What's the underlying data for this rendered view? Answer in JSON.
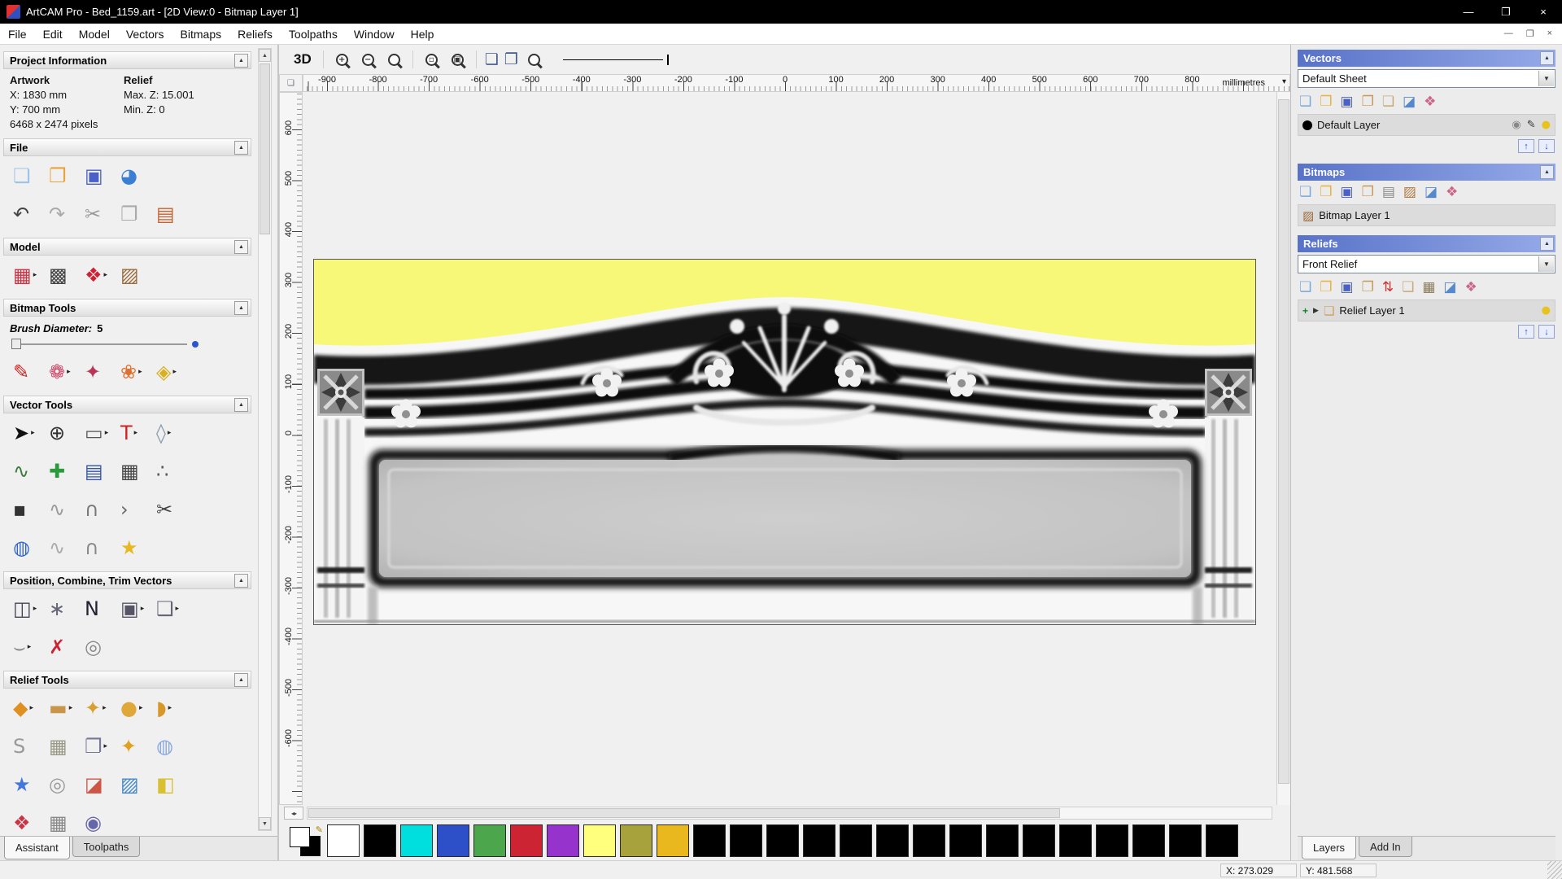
{
  "ui": {
    "collapse_glyph": "▲",
    "dropdown_glyph": "▼",
    "flyout_glyph": "▸",
    "updown": [
      "↑",
      "↓"
    ],
    "hsplit_glyph": "◂▸",
    "ruler_corner_glyph": "❏",
    "ruler_drop_glyph": "▾",
    "header_blue_from": "#5872c8",
    "header_blue_to": "#95aae8",
    "palette_edit_glyph": "✎"
  },
  "titlebar": {
    "title": "ArtCAM Pro - Bed_1159.art - [2D View:0 - Bitmap Layer 1]",
    "minimize": "—",
    "maximize": "❐",
    "close": "×"
  },
  "menubar": {
    "items": [
      "File",
      "Edit",
      "Model",
      "Vectors",
      "Bitmaps",
      "Reliefs",
      "Toolpaths",
      "Window",
      "Help"
    ],
    "mdi": [
      {
        "name": "mdi-minimize-button",
        "glyph": "—"
      },
      {
        "name": "mdi-restore-button",
        "glyph": "❐"
      },
      {
        "name": "mdi-close-button",
        "glyph": "×"
      }
    ]
  },
  "left_panel": {
    "project_info": {
      "title": "Project Information",
      "artwork_label": "Artwork",
      "relief_label": "Relief",
      "x_value": "X: 1830 mm",
      "max_z": "Max. Z: 15.001",
      "y_value": "Y: 700 mm",
      "min_z": "Min. Z: 0",
      "pixels": "6468 x 2474 pixels"
    },
    "file": {
      "title": "File",
      "row1": [
        {
          "name": "new-model-icon",
          "glyph": "❏",
          "color": "#9ec2e8"
        },
        {
          "name": "open-model-icon",
          "glyph": "❐",
          "color": "#e8a33d"
        },
        {
          "name": "save-model-icon",
          "glyph": "▣",
          "color": "#4a5fc8"
        },
        {
          "name": "model-transfer-icon",
          "glyph": "◕",
          "color": "#3a7fd4"
        }
      ],
      "row2": [
        {
          "name": "undo-icon",
          "glyph": "↶",
          "color": "#444444"
        },
        {
          "name": "redo-icon",
          "glyph": "↷",
          "color": "#aaaaaa"
        },
        {
          "name": "cut-icon",
          "glyph": "✂",
          "color": "#999999"
        },
        {
          "name": "copy-icon",
          "glyph": "❐",
          "color": "#aaaaaa"
        },
        {
          "name": "paste-icon",
          "glyph": "▤",
          "color": "#c86030"
        }
      ]
    },
    "model": {
      "title": "Model",
      "row1": [
        {
          "name": "set-model-size-icon",
          "glyph": "▦",
          "color": "#cc3344",
          "arrow": true
        },
        {
          "name": "model-notes-icon",
          "glyph": "▩",
          "color": "#444444"
        },
        {
          "name": "relief-sculpt-icon",
          "glyph": "❖",
          "color": "#cc2233",
          "arrow": true
        },
        {
          "name": "load-bitmap-icon",
          "glyph": "▨",
          "color": "#9a6a3a"
        }
      ]
    },
    "bitmap_tools": {
      "title": "Bitmap Tools",
      "brush_label": "Brush Diameter:",
      "brush_value": "5",
      "row1": [
        {
          "name": "paint-brush-icon",
          "glyph": "✎",
          "color": "#cc2222"
        },
        {
          "name": "paint-selective-icon",
          "glyph": "❁",
          "color": "#cc4466",
          "arrow": true
        },
        {
          "name": "colour-picker-icon",
          "glyph": "✦",
          "color": "#bb3355"
        },
        {
          "name": "colour-palette-icon",
          "glyph": "❀",
          "color": "#e07030",
          "arrow": true
        },
        {
          "name": "flood-fill-icon",
          "glyph": "◈",
          "color": "#d8b020",
          "arrow": true
        }
      ]
    },
    "vector_tools": {
      "title": "Vector Tools",
      "row1": [
        {
          "name": "select-vectors-icon",
          "glyph": "➤",
          "color": "#111111",
          "arrow": true
        },
        {
          "name": "transform-vectors-icon",
          "glyph": "⊕",
          "color": "#333333"
        },
        {
          "name": "create-rectangle-icon",
          "glyph": "▭",
          "color": "#555555",
          "arrow": true
        },
        {
          "name": "create-text-icon",
          "glyph": "T",
          "color": "#cc2222",
          "arrow": true
        },
        {
          "name": "measure-icon",
          "glyph": "◊",
          "color": "#8899aa",
          "arrow": true
        }
      ],
      "row2": [
        {
          "name": "create-polyline-icon",
          "glyph": "∿",
          "color": "#3a7a3a"
        },
        {
          "name": "snap-options-icon",
          "glyph": "✚",
          "color": "#2a9a3a"
        },
        {
          "name": "text-block-icon",
          "glyph": "▤",
          "color": "#3355aa"
        },
        {
          "name": "bitmap-to-vector-icon",
          "glyph": "▦",
          "color": "#444444"
        },
        {
          "name": "node-editing-icon",
          "glyph": "∴",
          "color": "#555555"
        }
      ],
      "row3": [
        {
          "name": "create-point-icon",
          "glyph": "▪",
          "color": "#333333"
        },
        {
          "name": "freehand-curve-icon",
          "glyph": "∿",
          "color": "#999999"
        },
        {
          "name": "create-arc-icon",
          "glyph": "∩",
          "color": "#777777"
        },
        {
          "name": "polyline-segment-icon",
          "glyph": "›",
          "color": "#666666"
        },
        {
          "name": "trim-vectors-icon",
          "glyph": "✂",
          "color": "#444444"
        }
      ],
      "row4": [
        {
          "name": "offset-vectors-icon",
          "glyph": "◍",
          "color": "#3366cc"
        },
        {
          "name": "fillet-icon",
          "glyph": "∿",
          "color": "#aaaaaa"
        },
        {
          "name": "join-vectors-icon",
          "glyph": "∩",
          "color": "#888888"
        },
        {
          "name": "vector-wizard-icon",
          "glyph": "★",
          "color": "#e8b820"
        }
      ]
    },
    "position_tools": {
      "title": "Position, Combine, Trim Vectors",
      "row1": [
        {
          "name": "align-vectors-icon",
          "glyph": "◫",
          "color": "#444455",
          "arrow": true
        },
        {
          "name": "array-copy-icon",
          "glyph": "∗",
          "color": "#666677"
        },
        {
          "name": "nesting-icon",
          "glyph": "N",
          "color": "#222233"
        },
        {
          "name": "group-vectors-icon",
          "glyph": "▣",
          "color": "#555566",
          "arrow": true
        },
        {
          "name": "weld-vectors-icon",
          "glyph": "❑",
          "color": "#666677",
          "arrow": true
        }
      ],
      "row2": [
        {
          "name": "slice-vectors-icon",
          "glyph": "⌣",
          "color": "#888888",
          "arrow": true
        },
        {
          "name": "vector-doctor-icon",
          "glyph": "✗",
          "color": "#cc2233"
        },
        {
          "name": "fit-spiral-icon",
          "glyph": "◎",
          "color": "#888888"
        }
      ]
    },
    "relief_tools": {
      "title": "Relief Tools",
      "row1": [
        {
          "name": "shape-editor-icon",
          "glyph": "◆",
          "color": "#e09020",
          "arrow": true
        },
        {
          "name": "smooth-relief-icon",
          "glyph": "▬",
          "color": "#c8954a",
          "arrow": true
        },
        {
          "name": "sculpting-icon",
          "glyph": "✦",
          "color": "#d8a030",
          "arrow": true
        },
        {
          "name": "add-subtract-relief-icon",
          "glyph": "●",
          "color": "#e0a838",
          "arrow": true
        },
        {
          "name": "relief-properties-icon",
          "glyph": "◗",
          "color": "#d89828",
          "arrow": true
        }
      ],
      "row2": [
        {
          "name": "smoothing-icon",
          "glyph": "S",
          "color": "#999999"
        },
        {
          "name": "texture-relief-icon",
          "glyph": "▦",
          "color": "#999988"
        },
        {
          "name": "relief-from-image-icon",
          "glyph": "❐",
          "color": "#777799",
          "arrow": true
        },
        {
          "name": "interactive-sculpt-icon",
          "glyph": "✦",
          "color": "#e0a020"
        },
        {
          "name": "dome-relief-icon",
          "glyph": "◍",
          "color": "#88a8e0"
        }
      ],
      "row3": [
        {
          "name": "star-wizard-icon",
          "glyph": "★",
          "color": "#4477dd"
        },
        {
          "name": "swirl-relief-icon",
          "glyph": "◎",
          "color": "#999999"
        },
        {
          "name": "angled-plane-icon",
          "glyph": "◪",
          "color": "#cc5544"
        },
        {
          "name": "weave-wizard-icon",
          "glyph": "▨",
          "color": "#4488cc"
        },
        {
          "name": "extrude-icon",
          "glyph": "◧",
          "color": "#d8c030"
        }
      ],
      "row4": [
        {
          "name": "two-rail-sweep-icon",
          "glyph": "❖",
          "color": "#cc3344"
        },
        {
          "name": "turn-model-icon",
          "glyph": "▦",
          "color": "#888888"
        },
        {
          "name": "isolate-relief-icon",
          "glyph": "◉",
          "color": "#6666aa"
        }
      ]
    },
    "tabs": [
      {
        "name": "tab-assistant",
        "label": "Assistant",
        "active": true
      },
      {
        "name": "tab-toolpaths",
        "label": "Toolpaths",
        "active": false
      }
    ]
  },
  "canvas": {
    "toolbar": {
      "view3d_label": "3D",
      "zoom_in_sym": "+",
      "zoom_out_sym": "−",
      "zoom_box_sym": "▫",
      "zoom_fit_sym": "▣",
      "page_sym": "❏",
      "objects_sym": "❐"
    },
    "ruler_h": [
      "-900",
      "-800",
      "-700",
      "-600",
      "-500",
      "-400",
      "-300",
      "-200",
      "-100",
      "0",
      "100",
      "200",
      "300",
      "400",
      "500",
      "600",
      "700",
      "800"
    ],
    "ruler_v": [
      "600",
      "500",
      "400",
      "300",
      "200",
      "100",
      "0",
      "-100",
      "-200",
      "-300",
      "-400",
      "-500",
      "-600"
    ],
    "ruler_units": "millimetres"
  },
  "artwork": {
    "top_color": "#f7f778"
  },
  "right_panel": {
    "vectors": {
      "title": "Vectors",
      "sheet_value": "Default Sheet",
      "tools": [
        {
          "name": "new-vector-layer-icon",
          "glyph": "❏",
          "color": "#7aa8d8"
        },
        {
          "name": "open-vector-layer-icon",
          "glyph": "❐",
          "color": "#e8b23d"
        },
        {
          "name": "save-vector-layer-icon",
          "glyph": "▣",
          "color": "#4a5fc8"
        },
        {
          "name": "import-vectors-icon",
          "glyph": "❐",
          "color": "#c89858"
        },
        {
          "name": "export-vectors-icon",
          "glyph": "❏",
          "color": "#c8a878"
        },
        {
          "name": "delete-vector-layer-icon",
          "glyph": "◪",
          "color": "#5588cc"
        },
        {
          "name": "vector-layer-colours-icon",
          "glyph": "❖",
          "color": "#cc6688"
        }
      ],
      "layer": {
        "color": "#000000",
        "label": "Default Layer",
        "icons": [
          {
            "name": "snap-layer-icon",
            "glyph": "◉",
            "color": "#888888"
          },
          {
            "name": "edit-layer-colour-icon",
            "glyph": "✎",
            "color": "#333333"
          },
          {
            "name": "layer-visibility-icon",
            "glyph": "●",
            "color": "#e8c31e"
          }
        ]
      }
    },
    "bitmaps": {
      "title": "Bitmaps",
      "tools": [
        {
          "name": "new-bitmap-layer-icon",
          "glyph": "❏",
          "color": "#7aa8d8"
        },
        {
          "name": "open-bitmap-layer-icon",
          "glyph": "❐",
          "color": "#e8b23d"
        },
        {
          "name": "save-bitmap-layer-icon",
          "glyph": "▣",
          "color": "#4a5fc8"
        },
        {
          "name": "import-bitmap-icon",
          "glyph": "❐",
          "color": "#c89858"
        },
        {
          "name": "greyscale-view-icon",
          "glyph": "▤",
          "color": "#888888"
        },
        {
          "name": "bitmap-image-icon",
          "glyph": "▨",
          "color": "#b07840"
        },
        {
          "name": "delete-bitmap-layer-icon",
          "glyph": "◪",
          "color": "#5588cc"
        },
        {
          "name": "bitmap-colours-icon",
          "glyph": "❖",
          "color": "#cc6688"
        }
      ],
      "layer": {
        "label": "Bitmap Layer 1"
      }
    },
    "reliefs": {
      "title": "Reliefs",
      "combo_value": "Front Relief",
      "tools": [
        {
          "name": "new-relief-layer-icon",
          "glyph": "❏",
          "color": "#7aa8d8"
        },
        {
          "name": "open-relief-layer-icon",
          "glyph": "❐",
          "color": "#e8b23d"
        },
        {
          "name": "save-relief-layer-icon",
          "glyph": "▣",
          "color": "#4a5fc8"
        },
        {
          "name": "import-relief-icon",
          "glyph": "❐",
          "color": "#c89858"
        },
        {
          "name": "transfer-relief-icon",
          "glyph": "⇅",
          "color": "#cc3333"
        },
        {
          "name": "paste-relief-icon",
          "glyph": "❏",
          "color": "#c8a878"
        },
        {
          "name": "relief-grid-icon",
          "glyph": "▦",
          "color": "#8a7a5a"
        },
        {
          "name": "delete-relief-layer-icon",
          "glyph": "◪",
          "color": "#5588cc"
        },
        {
          "name": "relief-colours-icon",
          "glyph": "❖",
          "color": "#cc6688"
        }
      ],
      "layer": {
        "plus": "+",
        "expander": "▶",
        "label": "Relief Layer 1",
        "bulb": "●"
      }
    },
    "tabs": [
      {
        "name": "tab-layers",
        "label": "Layers",
        "active": true
      },
      {
        "name": "tab-addin",
        "label": "Add In",
        "active": false
      }
    ]
  },
  "palette": {
    "swatches": [
      "#ffffff",
      "#000000",
      "#00dede",
      "#2d4fc8",
      "#4ca64c",
      "#cc2433",
      "#9633cc",
      "#ffff7d",
      "#a8a23c",
      "#e8b81e",
      "#000000",
      "#000000",
      "#000000",
      "#000000",
      "#000000",
      "#000000",
      "#000000",
      "#000000",
      "#000000",
      "#000000",
      "#000000",
      "#000000",
      "#000000",
      "#000000",
      "#000000"
    ]
  },
  "statusbar": {
    "x": "X: 273.029",
    "y": "Y: 481.568"
  }
}
